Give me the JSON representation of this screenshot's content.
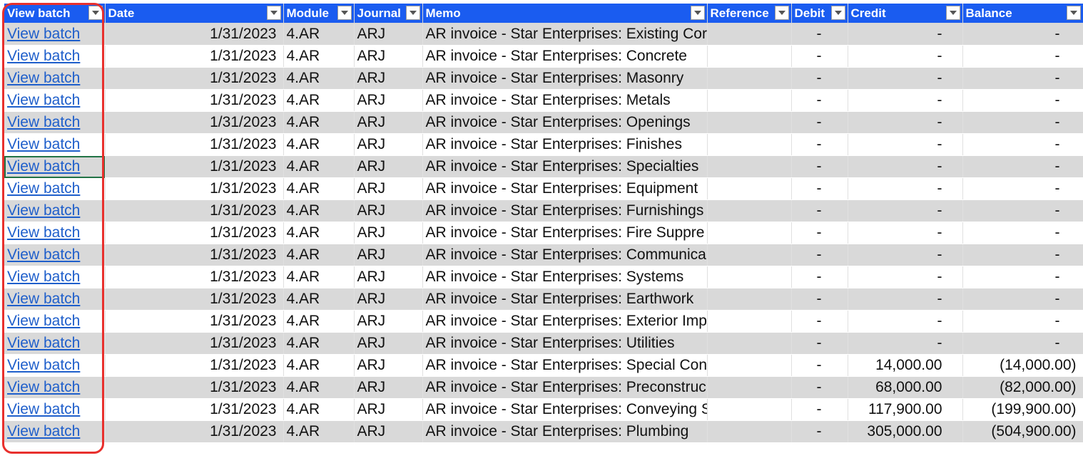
{
  "headers": [
    "View batch",
    "Date",
    "Module",
    "Journal",
    "Memo",
    "Reference",
    "Debit",
    "Credit",
    "Balance"
  ],
  "highlight_color": "#e8302d",
  "header_color": "#1a5cf0",
  "rows": [
    {
      "link": "View batch",
      "date": "1/31/2023",
      "module": "4.AR",
      "journal": "ARJ",
      "memo": "AR invoice - Star Enterprises: Existing Cor",
      "reference": "",
      "debit": "-",
      "credit": "-",
      "balance": "-"
    },
    {
      "link": "View batch",
      "date": "1/31/2023",
      "module": "4.AR",
      "journal": "ARJ",
      "memo": "AR invoice - Star Enterprises: Concrete",
      "reference": "",
      "debit": "-",
      "credit": "-",
      "balance": "-"
    },
    {
      "link": "View batch",
      "date": "1/31/2023",
      "module": "4.AR",
      "journal": "ARJ",
      "memo": "AR invoice - Star Enterprises: Masonry",
      "reference": "",
      "debit": "-",
      "credit": "-",
      "balance": "-"
    },
    {
      "link": "View batch",
      "date": "1/31/2023",
      "module": "4.AR",
      "journal": "ARJ",
      "memo": "AR invoice - Star Enterprises: Metals",
      "reference": "",
      "debit": "-",
      "credit": "-",
      "balance": "-"
    },
    {
      "link": "View batch",
      "date": "1/31/2023",
      "module": "4.AR",
      "journal": "ARJ",
      "memo": "AR invoice - Star Enterprises: Openings",
      "reference": "",
      "debit": "-",
      "credit": "-",
      "balance": "-"
    },
    {
      "link": "View batch",
      "date": "1/31/2023",
      "module": "4.AR",
      "journal": "ARJ",
      "memo": "AR invoice - Star Enterprises: Finishes",
      "reference": "",
      "debit": "-",
      "credit": "-",
      "balance": "-"
    },
    {
      "link": "View batch",
      "date": "1/31/2023",
      "module": "4.AR",
      "journal": "ARJ",
      "memo": "AR invoice - Star Enterprises: Specialties",
      "reference": "",
      "debit": "-",
      "credit": "-",
      "balance": "-"
    },
    {
      "link": "View batch",
      "date": "1/31/2023",
      "module": "4.AR",
      "journal": "ARJ",
      "memo": "AR invoice - Star Enterprises: Equipment",
      "reference": "",
      "debit": "-",
      "credit": "-",
      "balance": "-"
    },
    {
      "link": "View batch",
      "date": "1/31/2023",
      "module": "4.AR",
      "journal": "ARJ",
      "memo": "AR invoice - Star Enterprises: Furnishings",
      "reference": "",
      "debit": "-",
      "credit": "-",
      "balance": "-"
    },
    {
      "link": "View batch",
      "date": "1/31/2023",
      "module": "4.AR",
      "journal": "ARJ",
      "memo": "AR invoice - Star Enterprises: Fire Suppre",
      "reference": "",
      "debit": "-",
      "credit": "-",
      "balance": "-"
    },
    {
      "link": "View batch",
      "date": "1/31/2023",
      "module": "4.AR",
      "journal": "ARJ",
      "memo": "AR invoice - Star Enterprises: Communica",
      "reference": "",
      "debit": "-",
      "credit": "-",
      "balance": "-"
    },
    {
      "link": "View batch",
      "date": "1/31/2023",
      "module": "4.AR",
      "journal": "ARJ",
      "memo": "AR invoice - Star Enterprises: Systems",
      "reference": "",
      "debit": "-",
      "credit": "-",
      "balance": "-"
    },
    {
      "link": "View batch",
      "date": "1/31/2023",
      "module": "4.AR",
      "journal": "ARJ",
      "memo": "AR invoice - Star Enterprises: Earthwork",
      "reference": "",
      "debit": "-",
      "credit": "-",
      "balance": "-"
    },
    {
      "link": "View batch",
      "date": "1/31/2023",
      "module": "4.AR",
      "journal": "ARJ",
      "memo": "AR invoice - Star Enterprises: Exterior Imp",
      "reference": "",
      "debit": "-",
      "credit": "-",
      "balance": "-"
    },
    {
      "link": "View batch",
      "date": "1/31/2023",
      "module": "4.AR",
      "journal": "ARJ",
      "memo": "AR invoice - Star Enterprises: Utilities",
      "reference": "",
      "debit": "-",
      "credit": "-",
      "balance": "-"
    },
    {
      "link": "View batch",
      "date": "1/31/2023",
      "module": "4.AR",
      "journal": "ARJ",
      "memo": "AR invoice - Star Enterprises: Special Con",
      "reference": "",
      "debit": "-",
      "credit": "14,000.00",
      "balance": "(14,000.00)"
    },
    {
      "link": "View batch",
      "date": "1/31/2023",
      "module": "4.AR",
      "journal": "ARJ",
      "memo": "AR invoice - Star Enterprises: Preconstruc",
      "reference": "",
      "debit": "-",
      "credit": "68,000.00",
      "balance": "(82,000.00)"
    },
    {
      "link": "View batch",
      "date": "1/31/2023",
      "module": "4.AR",
      "journal": "ARJ",
      "memo": "AR invoice - Star Enterprises: Conveying S",
      "reference": "",
      "debit": "-",
      "credit": "117,900.00",
      "balance": "(199,900.00)"
    },
    {
      "link": "View batch",
      "date": "1/31/2023",
      "module": "4.AR",
      "journal": "ARJ",
      "memo": "AR invoice - Star Enterprises: Plumbing",
      "reference": "",
      "debit": "-",
      "credit": "305,000.00",
      "balance": "(504,900.00)"
    }
  ]
}
